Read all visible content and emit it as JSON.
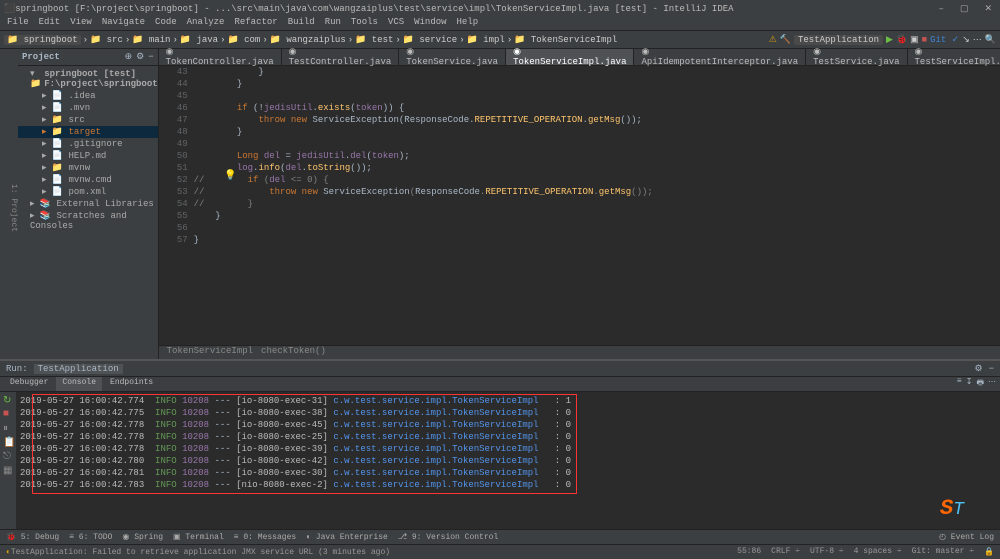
{
  "window": {
    "title": "springboot [F:\\project\\springboot] - ...\\src\\main\\java\\com\\wangzaiplus\\test\\service\\impl\\TokenServiceImpl.java [test] - IntelliJ IDEA"
  },
  "menu": [
    "File",
    "Edit",
    "View",
    "Navigate",
    "Code",
    "Analyze",
    "Refactor",
    "Build",
    "Run",
    "Tools",
    "VCS",
    "Window",
    "Help"
  ],
  "breadcrumbs": [
    "springboot",
    "src",
    "main",
    "java",
    "com",
    "wangzaiplus",
    "test",
    "service",
    "impl",
    "TokenServiceImpl"
  ],
  "run_config": "TestApplication",
  "project_panel": {
    "title": "Project"
  },
  "tree": {
    "root": "springboot [test] F:\\project\\springboot",
    "items": [
      ".idea",
      ".mvn",
      "src",
      "target",
      ".gitignore",
      "HELP.md",
      "mvnw",
      "mvnw.cmd",
      "pom.xml"
    ],
    "ext": [
      "External Libraries",
      "Scratches and Consoles"
    ]
  },
  "editor_tabs": [
    {
      "label": "TokenController.java",
      "active": false
    },
    {
      "label": "TestController.java",
      "active": false
    },
    {
      "label": "TokenService.java",
      "active": false
    },
    {
      "label": "TokenServiceImpl.java",
      "active": true
    },
    {
      "label": "ApiIdempotentInterceptor.java",
      "active": false
    },
    {
      "label": "TestService.java",
      "active": false
    },
    {
      "label": "TestServiceImpl.java",
      "active": false
    }
  ],
  "code": {
    "lines": [
      {
        "n": 43,
        "t": "            }"
      },
      {
        "n": 44,
        "t": "        }"
      },
      {
        "n": 45,
        "t": ""
      },
      {
        "n": 46,
        "t": "        if (!jedisUtil.exists(token)) {"
      },
      {
        "n": 47,
        "t": "            throw new ServiceException(ResponseCode.REPETITIVE_OPERATION.getMsg());"
      },
      {
        "n": 48,
        "t": "        }"
      },
      {
        "n": 49,
        "t": ""
      },
      {
        "n": 50,
        "t": "        Long del = jedisUtil.del(token);"
      },
      {
        "n": 51,
        "t": "        log.info(del.toString());"
      },
      {
        "n": 52,
        "t": "//        if (del <= 0) {"
      },
      {
        "n": 53,
        "t": "//            throw new ServiceException(ResponseCode.REPETITIVE_OPERATION.getMsg());"
      },
      {
        "n": 54,
        "t": "//        }"
      },
      {
        "n": 55,
        "t": "    }"
      },
      {
        "n": 56,
        "t": ""
      },
      {
        "n": 57,
        "t": "}"
      }
    ]
  },
  "breadcrumb_btm": [
    "TokenServiceImpl",
    "checkToken()"
  ],
  "run_panel": {
    "title": "Run:",
    "app": "TestApplication",
    "tabs": [
      "Debugger",
      "Console",
      "Endpoints"
    ]
  },
  "console": [
    {
      "ts": "2019-05-27 16:00:42.774",
      "lvl": "INFO",
      "pid": "10208",
      "thread": "[io-8080-exec-31]",
      "logger": "c.w.test.service.impl.TokenServiceImpl",
      "msg": ": 1"
    },
    {
      "ts": "2019-05-27 16:00:42.775",
      "lvl": "INFO",
      "pid": "10208",
      "thread": "[io-8080-exec-38]",
      "logger": "c.w.test.service.impl.TokenServiceImpl",
      "msg": ": 0"
    },
    {
      "ts": "2019-05-27 16:00:42.778",
      "lvl": "INFO",
      "pid": "10208",
      "thread": "[io-8080-exec-45]",
      "logger": "c.w.test.service.impl.TokenServiceImpl",
      "msg": ": 0"
    },
    {
      "ts": "2019-05-27 16:00:42.778",
      "lvl": "INFO",
      "pid": "10208",
      "thread": "[io-8080-exec-25]",
      "logger": "c.w.test.service.impl.TokenServiceImpl",
      "msg": ": 0"
    },
    {
      "ts": "2019-05-27 16:00:42.778",
      "lvl": "INFO",
      "pid": "10208",
      "thread": "[io-8080-exec-39]",
      "logger": "c.w.test.service.impl.TokenServiceImpl",
      "msg": ": 0"
    },
    {
      "ts": "2019-05-27 16:00:42.780",
      "lvl": "INFO",
      "pid": "10208",
      "thread": "[io-8080-exec-42]",
      "logger": "c.w.test.service.impl.TokenServiceImpl",
      "msg": ": 0"
    },
    {
      "ts": "2019-05-27 16:00:42.781",
      "lvl": "INFO",
      "pid": "10208",
      "thread": "[io-8080-exec-30]",
      "logger": "c.w.test.service.impl.TokenServiceImpl",
      "msg": ": 0"
    },
    {
      "ts": "2019-05-27 16:00:42.783",
      "lvl": "INFO",
      "pid": "10208",
      "thread": "[nio-8080-exec-2]",
      "logger": "c.w.test.service.impl.TokenServiceImpl",
      "msg": ": 0"
    }
  ],
  "bottom_tabs": [
    "Debug",
    "TODO",
    "Spring",
    "Terminal",
    "Messages",
    "Java Enterprise",
    "Version Control"
  ],
  "event_log": "Event Log",
  "status": {
    "msg": "TestApplication: Failed to retrieve application JMX service URL (3 minutes ago)",
    "pos": "55:86",
    "sep": "CRLF ÷",
    "enc": "UTF-8 ÷",
    "indent": "4 spaces ÷",
    "git": "Git: master ÷"
  }
}
